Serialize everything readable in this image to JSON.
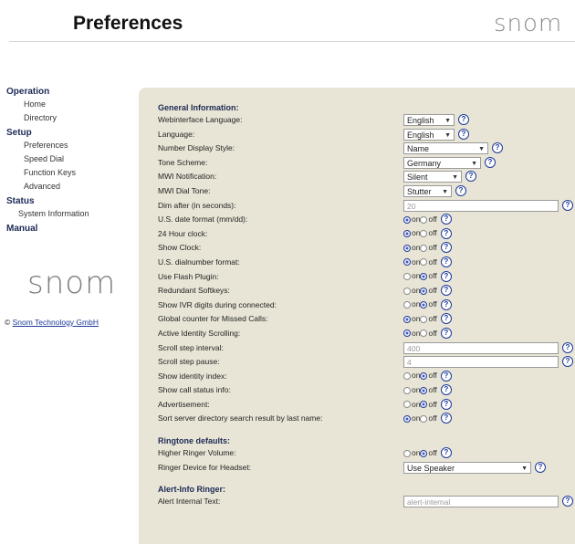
{
  "header": {
    "title": "Preferences",
    "logo_text": "snom"
  },
  "sidebar": {
    "sections": [
      {
        "title": "Operation",
        "items": [
          "Home",
          "Directory"
        ]
      },
      {
        "title": "Setup",
        "items": [
          "Preferences",
          "Speed Dial",
          "Function Keys",
          "Advanced"
        ]
      },
      {
        "title": "Status",
        "items": [
          "System Information"
        ]
      },
      {
        "title": "Manual",
        "items": []
      }
    ],
    "logo_text": "snom",
    "copyright_symbol": "©",
    "copyright_link": "Snom Technology GmbH"
  },
  "radio_labels": {
    "on": "on",
    "off": "off"
  },
  "help_glyph": "?",
  "general": {
    "title": "General Information:",
    "rows": [
      {
        "label": "Webinterface Language:",
        "type": "select",
        "value": "English"
      },
      {
        "label": "Language:",
        "type": "select",
        "value": "English"
      },
      {
        "label": "Number Display Style:",
        "type": "select",
        "value": "Name"
      },
      {
        "label": "Tone Scheme:",
        "type": "select",
        "value": "Germany"
      },
      {
        "label": "MWI Notification:",
        "type": "select",
        "value": "Silent"
      },
      {
        "label": "MWI Dial Tone:",
        "type": "select",
        "value": "Stutter"
      },
      {
        "label": "Dim after (in seconds):",
        "type": "text",
        "value": "20"
      },
      {
        "label": "U.S. date format (mm/dd):",
        "type": "radio",
        "value": "on"
      },
      {
        "label": "24 Hour clock:",
        "type": "radio",
        "value": "on"
      },
      {
        "label": "Show Clock:",
        "type": "radio",
        "value": "on"
      },
      {
        "label": "U.S. dialnumber format:",
        "type": "radio",
        "value": "on"
      },
      {
        "label": "Use Flash Plugin:",
        "type": "radio",
        "value": "off"
      },
      {
        "label": "Redundant Softkeys:",
        "type": "radio",
        "value": "off"
      },
      {
        "label": "Show IVR digits during connected:",
        "type": "radio",
        "value": "off"
      },
      {
        "label": "Global counter for Missed Calls:",
        "type": "radio",
        "value": "on"
      },
      {
        "label": "Active Identity Scrolling:",
        "type": "radio",
        "value": "on"
      },
      {
        "label": "Scroll step interval:",
        "type": "text",
        "value": "400"
      },
      {
        "label": "Scroll step pause:",
        "type": "text",
        "value": "4"
      },
      {
        "label": "Show identity index:",
        "type": "radio",
        "value": "off"
      },
      {
        "label": "Show call status info:",
        "type": "radio",
        "value": "off"
      },
      {
        "label": "Advertisement:",
        "type": "radio",
        "value": "off"
      },
      {
        "label": "Sort server directory search result by last name:",
        "type": "radio",
        "value": "on"
      }
    ]
  },
  "ringtone": {
    "title": "Ringtone defaults:",
    "rows": [
      {
        "label": "Higher Ringer Volume:",
        "type": "radio",
        "value": "off"
      },
      {
        "label": "Ringer Device for Headset:",
        "type": "select",
        "value": "Use Speaker"
      }
    ]
  },
  "alert": {
    "title": "Alert-Info Ringer:",
    "rows": [
      {
        "label": "Alert Internal Text:",
        "type": "text",
        "value": "alert-internal"
      }
    ]
  }
}
